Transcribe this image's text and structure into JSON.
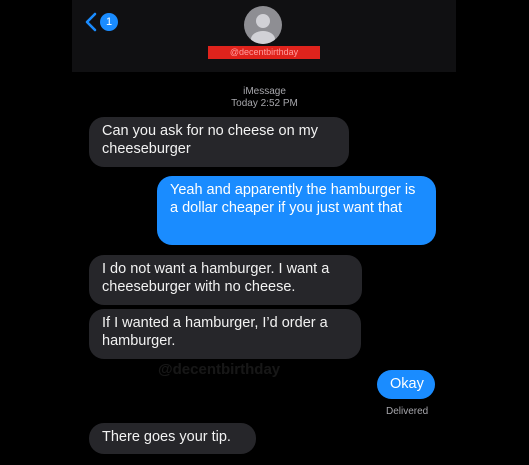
{
  "header": {
    "back_badge": "1",
    "contact_name": "@decentbirthday",
    "icons": {
      "back": "chevron-left-icon",
      "avatar": "person-silhouette-icon"
    }
  },
  "conversation": {
    "service": "iMessage",
    "timestamp": "Today 2:52 PM",
    "delivered": "Delivered",
    "watermark": "@decentbirthday"
  },
  "messages": [
    {
      "direction": "incoming",
      "text": "Can you ask for no cheese on my cheeseburger"
    },
    {
      "direction": "outgoing",
      "text": "Yeah and apparently the hamburger is a dollar cheaper if you just want that"
    },
    {
      "direction": "incoming",
      "text": "I do not want a hamburger. I want a cheeseburger with no cheese."
    },
    {
      "direction": "incoming",
      "text": "If I wanted a hamburger, I’d order a hamburger."
    },
    {
      "direction": "outgoing",
      "text": "Okay"
    },
    {
      "direction": "incoming",
      "text": "There goes your tip."
    }
  ],
  "colors": {
    "background": "#000000",
    "incoming_bubble": "#26262a",
    "outgoing_bubble": "#1a8cff",
    "name_highlight": "#e0231c"
  }
}
